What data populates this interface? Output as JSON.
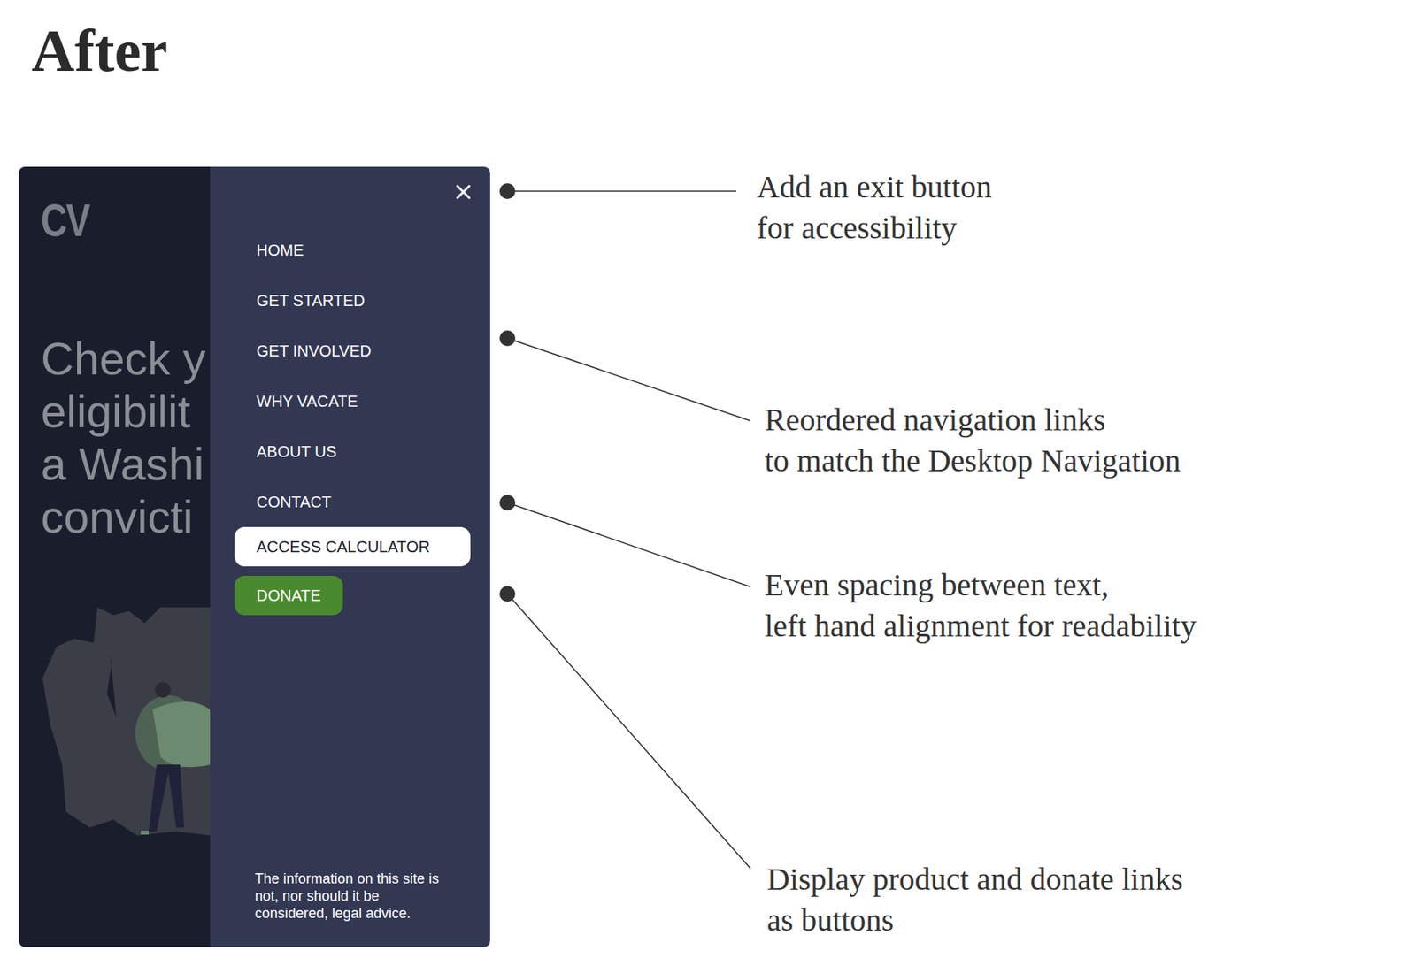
{
  "title": "After",
  "mockup": {
    "logo": "CV",
    "heading_lines": [
      "Check y",
      "eligibilit",
      "a Washi",
      "convicti"
    ],
    "nav_links": [
      {
        "label": "HOME"
      },
      {
        "label": "GET STARTED"
      },
      {
        "label": "GET INVOLVED"
      },
      {
        "label": "WHY VACATE"
      },
      {
        "label": "ABOUT US"
      },
      {
        "label": "CONTACT"
      }
    ],
    "buttons": [
      {
        "label": "ACCESS CALCULATOR",
        "kind": "primary"
      },
      {
        "label": "DONATE",
        "kind": "donate"
      }
    ],
    "disclaimer": "The information on this site is not, nor should it be considered, legal advice."
  },
  "annotations": [
    {
      "lines": [
        "Add an exit button",
        "for accessibility"
      ]
    },
    {
      "lines": [
        "Reordered navigation links",
        "to match the Desktop Navigation"
      ]
    },
    {
      "lines": [
        "Even spacing between text,",
        "left hand alignment for readability"
      ]
    },
    {
      "lines": [
        "Display product and donate links",
        "as buttons"
      ]
    }
  ]
}
